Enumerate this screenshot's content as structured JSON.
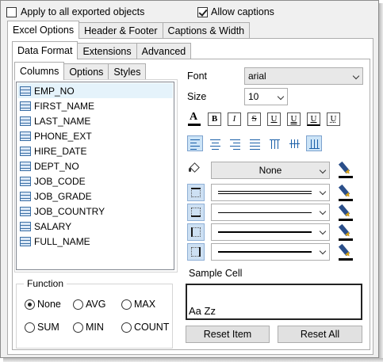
{
  "top_options": {
    "apply_all": {
      "label": "Apply to all exported objects",
      "checked": false
    },
    "allow_captions": {
      "label": "Allow captions",
      "checked": true
    }
  },
  "main_tabs": [
    "Excel Options",
    "Header & Footer",
    "Captions & Width"
  ],
  "sub_tabs": [
    "Data Format",
    "Extensions",
    "Advanced"
  ],
  "inner_tabs": [
    "Columns",
    "Options",
    "Styles"
  ],
  "columns": [
    "EMP_NO",
    "FIRST_NAME",
    "LAST_NAME",
    "PHONE_EXT",
    "HIRE_DATE",
    "DEPT_NO",
    "JOB_CODE",
    "JOB_GRADE",
    "JOB_COUNTRY",
    "SALARY",
    "FULL_NAME"
  ],
  "function_group": {
    "title": "Function",
    "options": [
      "None",
      "AVG",
      "MAX",
      "SUM",
      "MIN",
      "COUNT"
    ],
    "selected": "None"
  },
  "font": {
    "label": "Font",
    "value": "arial"
  },
  "size": {
    "label": "Size",
    "value": "10"
  },
  "format_buttons": [
    "A",
    "B",
    "I",
    "S",
    "U",
    "U",
    "U",
    "U"
  ],
  "fill": {
    "value": "None"
  },
  "sample": {
    "label": "Sample Cell",
    "text": "Aa Zz"
  },
  "buttons": {
    "reset_item": "Reset Item",
    "reset_all": "Reset All"
  }
}
